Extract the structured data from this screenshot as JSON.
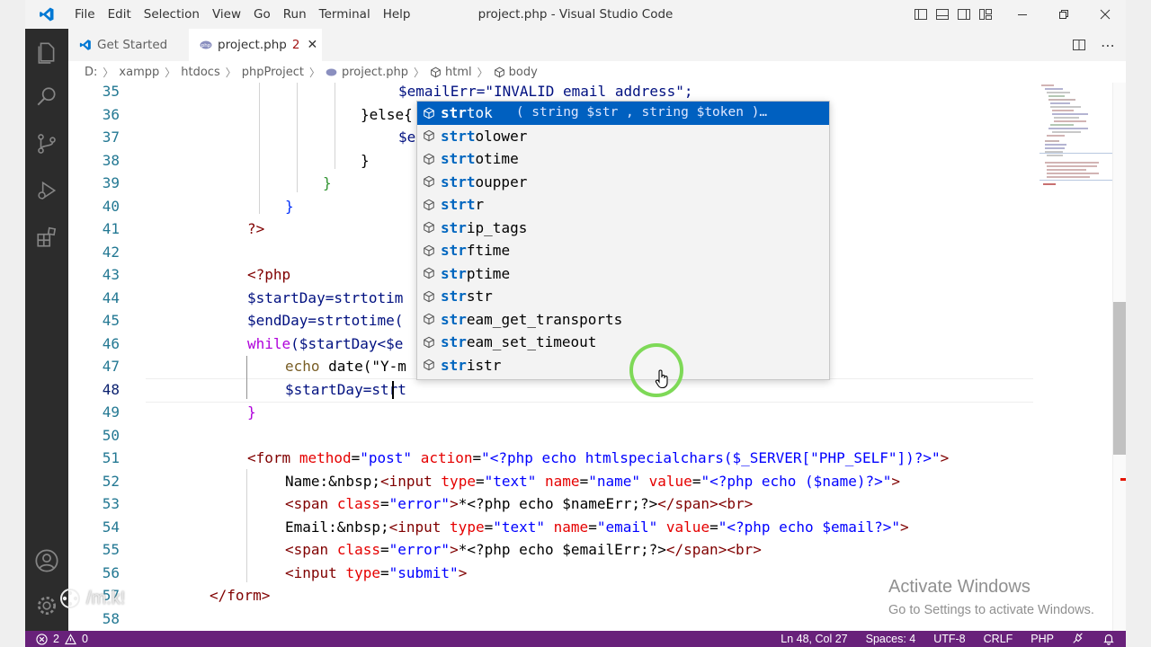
{
  "window": {
    "title": "project.php - Visual Studio Code"
  },
  "menu": [
    "File",
    "Edit",
    "Selection",
    "View",
    "Go",
    "Run",
    "Terminal",
    "Help"
  ],
  "tabs": [
    {
      "label": "Get Started",
      "active": false
    },
    {
      "label": "project.php",
      "badge": "2",
      "active": true
    }
  ],
  "breadcrumb": [
    "D:",
    "xampp",
    "htdocs",
    "phpProject",
    "project.php",
    "html",
    "body"
  ],
  "editor": {
    "line_numbers": [
      "35",
      "36",
      "37",
      "38",
      "39",
      "40",
      "41",
      "42",
      "43",
      "44",
      "45",
      "46",
      "47",
      "48",
      "49",
      "50",
      "51",
      "52",
      "53",
      "54",
      "55",
      "56",
      "57",
      "58"
    ],
    "current_line": "48",
    "lines": {
      "l35": "$emailErr=\"INVALID email address\";",
      "l36": "}else{",
      "l37": "$e",
      "l38": "}",
      "l39": "}",
      "l40": "}",
      "l41": "?>",
      "l43": "<?php",
      "l44": "$startDay=strtotim",
      "l45": "$endDay=strtotime(",
      "l46_kw": "while",
      "l46_rest": "($startDay<$e",
      "l47_kw": "echo",
      "l47_rest": " date(\"Y-m",
      "l48": "$startDay=strt",
      "l49": "}",
      "l51": [
        "<",
        "form",
        " ",
        "method",
        "=",
        "\"post\"",
        " ",
        "action",
        "=",
        "\"<?php echo htmlspecialchars($_SERVER[\"PHP_SELF\"])?>\"",
        ">"
      ],
      "l52": [
        "Name:&nbsp;",
        "<",
        "input",
        " ",
        "type",
        "=",
        "\"text\"",
        " ",
        "name",
        "=",
        "\"name\"",
        " ",
        "value",
        "=",
        "\"<?php echo ($name)?>\"",
        ">"
      ],
      "l53": [
        "<",
        "span",
        " ",
        "class",
        "=",
        "\"error\"",
        ">",
        "*<?php echo $nameErr;?>",
        "</",
        "span",
        "><",
        "br",
        ">"
      ],
      "l54": [
        "Email:&nbsp;",
        "<",
        "input",
        " ",
        "type",
        "=",
        "\"text\"",
        " ",
        "name",
        "=",
        "\"email\"",
        " ",
        "value",
        "=",
        "\"<?php echo $email?>\"",
        ">"
      ],
      "l55": [
        "<",
        "span",
        " ",
        "class",
        "=",
        "\"error\"",
        ">",
        "*<?php echo $emailErr;?>",
        "</",
        "span",
        "><",
        "br",
        ">"
      ],
      "l56": [
        "<",
        "input",
        " ",
        "type",
        "=",
        "\"submit\"",
        ">"
      ],
      "l57": [
        "</",
        "form",
        ">"
      ]
    }
  },
  "suggest": {
    "items": [
      {
        "match": "str",
        "rest": "tok",
        "detail": "( string $str , string $token )…",
        "selected": true
      },
      {
        "match": "strt",
        "rest": "olower"
      },
      {
        "match": "strt",
        "rest": "otime"
      },
      {
        "match": "strt",
        "rest": "oupper"
      },
      {
        "match": "strt",
        "rest": "r"
      },
      {
        "match": "str",
        "rest": "ip_tags"
      },
      {
        "match": "str",
        "rest": "ftime"
      },
      {
        "match": "str",
        "rest": "ptime"
      },
      {
        "match": "str",
        "rest": "str"
      },
      {
        "match": "str",
        "rest": "eam_get_transports"
      },
      {
        "match": "str",
        "rest": "eam_set_timeout"
      },
      {
        "match": "str",
        "rest": "istr"
      }
    ]
  },
  "status": {
    "errors": "2",
    "warnings": "0",
    "position": "Ln 48, Col 27",
    "spaces": "Spaces: 4",
    "encoding": "UTF-8",
    "eol": "CRLF",
    "language": "PHP"
  },
  "overlay": {
    "activate_title": "Activate Windows",
    "activate_sub": "Go to Settings to activate Windows.",
    "watermark": "/m.k!"
  },
  "colors": {
    "status_bar": "#68217a",
    "suggest_selected": "#0060c0",
    "activity_bar": "#2c2c2c"
  }
}
